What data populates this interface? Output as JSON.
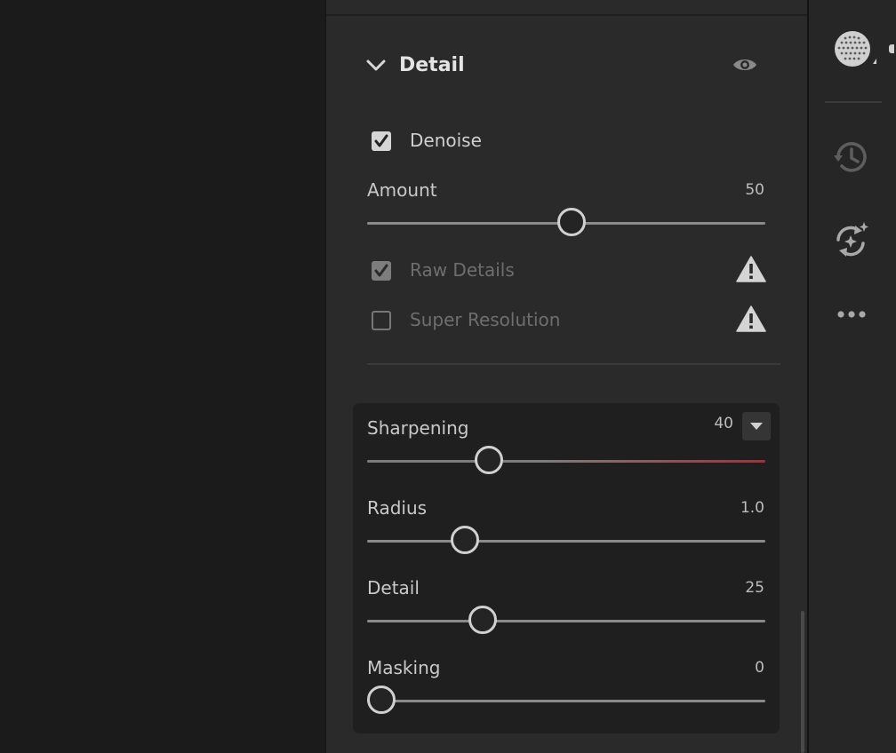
{
  "panel": {
    "section_title": "Detail",
    "denoise": {
      "label": "Denoise",
      "checked": true
    },
    "amount": {
      "label": "Amount",
      "value": "50",
      "fraction": 0.514
    },
    "raw_details": {
      "label": "Raw Details",
      "checked": true,
      "disabled": true
    },
    "super_resolution": {
      "label": "Super Resolution",
      "checked": false,
      "disabled": true
    },
    "sharpening": {
      "label": "Sharpening",
      "value": "40",
      "fraction": 0.291
    },
    "radius": {
      "label": "Radius",
      "value": "1.0",
      "fraction": 0.227
    },
    "detail": {
      "label": "Detail",
      "value": "25",
      "fraction": 0.274
    },
    "masking": {
      "label": "Masking",
      "value": "0",
      "fraction": 0.0
    }
  },
  "icons": {
    "collapse": "chevron-down-icon",
    "visibility": "eye-icon",
    "warning": "warning-icon",
    "dropdown": "triangle-down-icon",
    "history": "history-icon",
    "sync": "sync-sparkle-icon",
    "more": "more-icon",
    "avatar": "dotted-globe-icon"
  },
  "colors": {
    "panel_bg": "#2a2a2a",
    "group_bg": "#1f1f1f",
    "accent_red": "#a83a3a",
    "text": "#c9c9c9"
  }
}
